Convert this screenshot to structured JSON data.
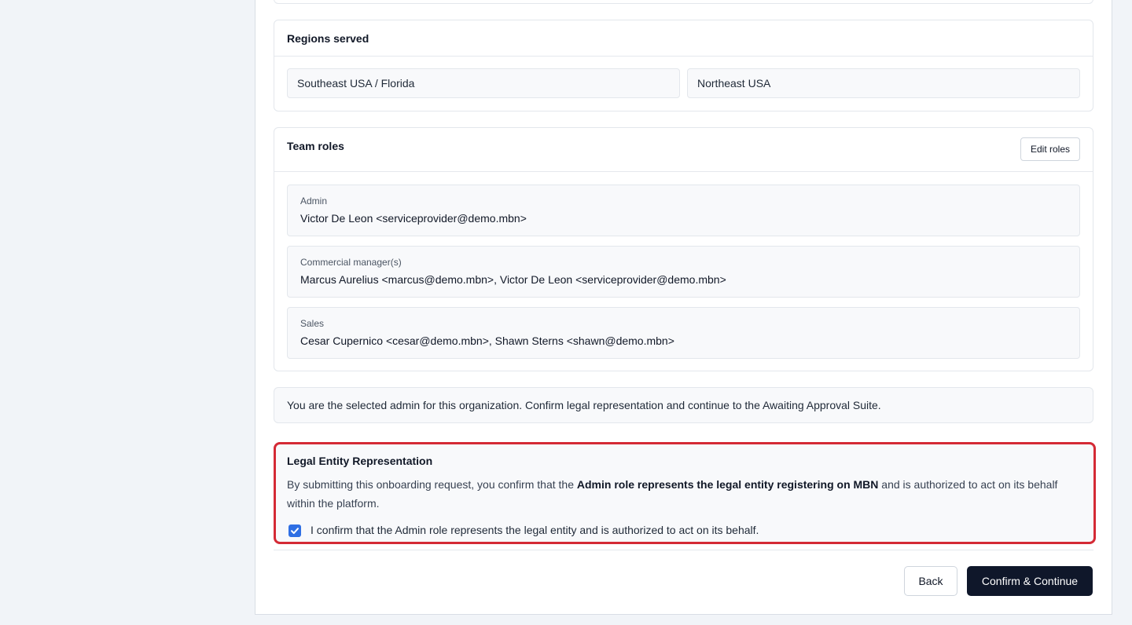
{
  "regions": {
    "title": "Regions served",
    "items": [
      "Southeast USA / Florida",
      "Northeast USA"
    ]
  },
  "team_roles": {
    "title": "Team roles",
    "edit_label": "Edit roles",
    "roles": [
      {
        "label": "Admin",
        "value": "Victor De Leon <serviceprovider@demo.mbn>"
      },
      {
        "label": "Commercial manager(s)",
        "value": "Marcus Aurelius <marcus@demo.mbn>, Victor De Leon <serviceprovider@demo.mbn>"
      },
      {
        "label": "Sales",
        "value": "Cesar Cupernico <cesar@demo.mbn>, Shawn Sterns <shawn@demo.mbn>"
      }
    ]
  },
  "info_message": "You are the selected admin for this organization. Confirm legal representation and continue to the Awaiting Approval Suite.",
  "legal": {
    "title": "Legal Entity Representation",
    "text_before": "By submitting this onboarding request, you confirm that the ",
    "text_bold": "Admin role represents the legal entity registering on MBN",
    "text_after": " and is authorized to act on its behalf within the platform.",
    "checkbox_checked": true,
    "checkbox_label": "I confirm that the Admin role represents the legal entity and is authorized to act on its behalf.",
    "border_color": "#d42a35"
  },
  "actions": {
    "back_label": "Back",
    "confirm_label": "Confirm & Continue"
  },
  "colors": {
    "primary_button": "#0f172a",
    "checkbox": "#2f6fe4",
    "page_background": "#f1f4f8"
  }
}
